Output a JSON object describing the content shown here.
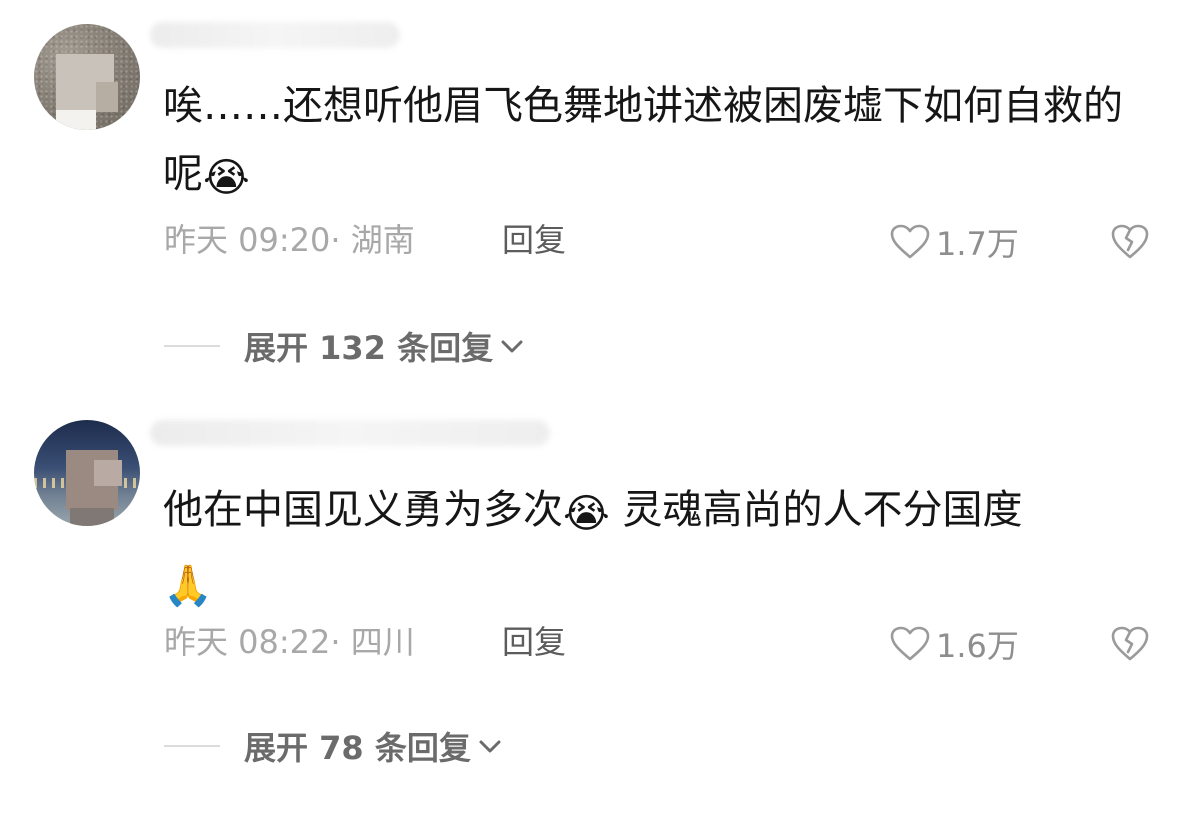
{
  "comments": [
    {
      "text": "唉……还想听他眉飞色舞地讲述被困废墟下如何自救的呢",
      "emoji": "😭",
      "time_location": "昨天 09:20· 湖南",
      "reply_label": "回复",
      "likes": "1.7万",
      "expand_label": "展开 132 条回复",
      "icons": [
        "heart-outline-icon",
        "broken-heart-icon",
        "chevron-down-icon"
      ]
    },
    {
      "text_part1": "他在中国见义勇为多次",
      "emoji1": "😭",
      "text_part2": " 灵魂高尚的人不分国度",
      "emoji2": "🙏",
      "time_location": "昨天 08:22· 四川",
      "reply_label": "回复",
      "likes": "1.6万",
      "expand_label": "展开 78 条回复",
      "icons": [
        "heart-outline-icon",
        "broken-heart-icon",
        "chevron-down-icon"
      ]
    }
  ],
  "colors": {
    "text_primary": "#161616",
    "text_meta": "#a8a8a8",
    "reply": "#5c5c5c",
    "expand": "#6b6b6b"
  }
}
